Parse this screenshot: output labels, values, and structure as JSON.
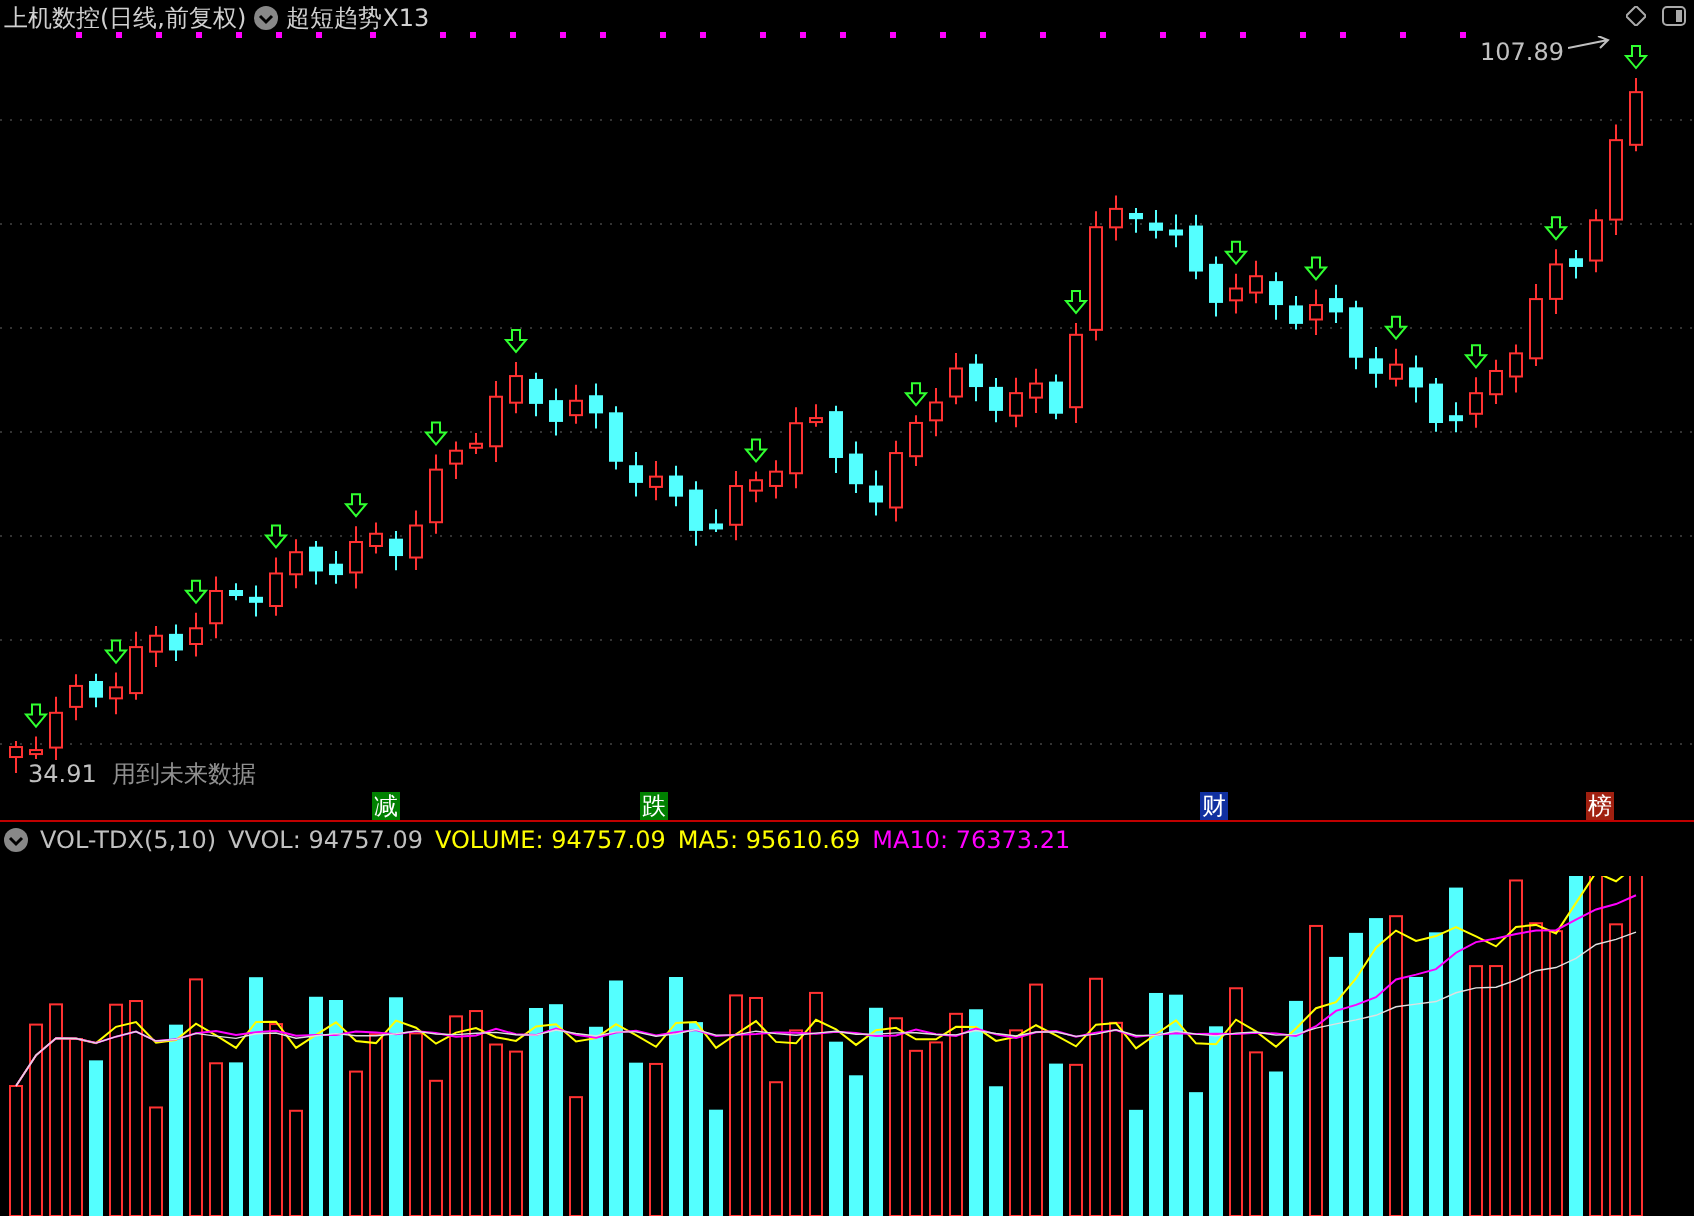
{
  "header": {
    "title": "上机数控(日线,前复权)",
    "indicator": "超短趋势X13"
  },
  "price_high": "107.89",
  "price_low": "34.91",
  "warning": "用到未来数据",
  "event_marks": [
    {
      "text": "减",
      "color": "#008000"
    },
    {
      "text": "跌",
      "color": "#008000"
    },
    {
      "text": "财",
      "color": "#1030a0"
    },
    {
      "text": "榜",
      "color": "#a02010"
    }
  ],
  "volume_panel": {
    "name": "VOL-TDX(5,10)",
    "values": [
      {
        "text": "VVOL: 94757.09",
        "color": "#c0c0c0"
      },
      {
        "text": "VOLUME: 94757.09",
        "color": "#ffff00"
      },
      {
        "text": "MA5: 95610.69",
        "color": "#ffff00"
      },
      {
        "text": "MA10: 76373.21",
        "color": "#ff00ff"
      }
    ]
  }
}
